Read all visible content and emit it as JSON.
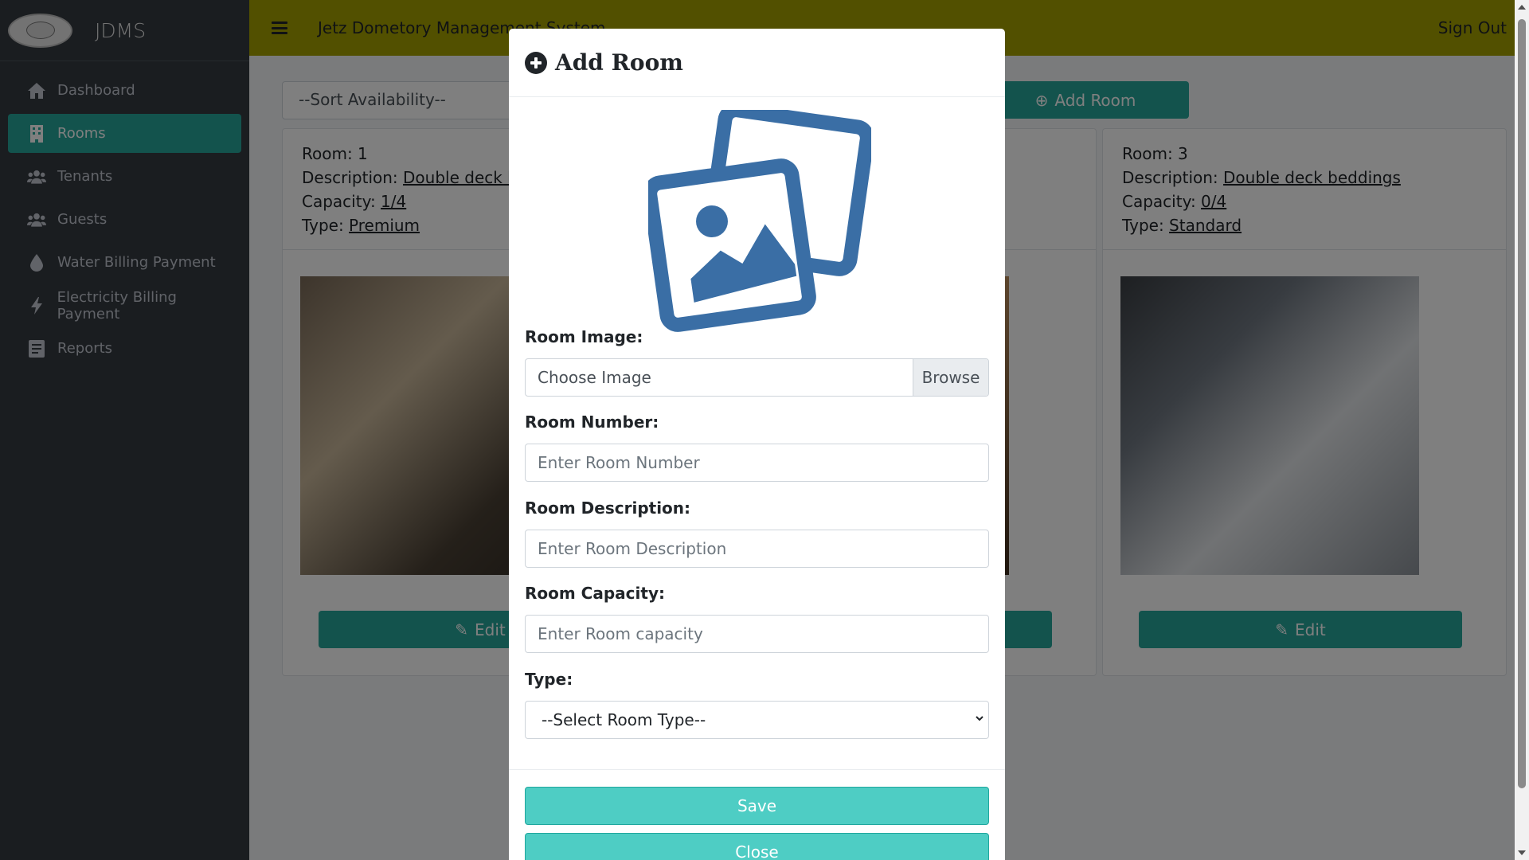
{
  "brand": {
    "name": "JDMS"
  },
  "header": {
    "title": "Jetz Dometory Management System",
    "sign_out": "Sign Out"
  },
  "sidebar": {
    "items": [
      {
        "label": "Dashboard",
        "icon": "home-icon"
      },
      {
        "label": "Rooms",
        "icon": "building-icon",
        "active": true
      },
      {
        "label": "Tenants",
        "icon": "users-icon"
      },
      {
        "label": "Guests",
        "icon": "users-icon"
      },
      {
        "label": "Water Billing Payment",
        "icon": "droplet-icon"
      },
      {
        "label": "Electricity Billing Payment",
        "icon": "bolt-icon"
      },
      {
        "label": "Reports",
        "icon": "report-icon"
      }
    ]
  },
  "main": {
    "sort_placeholder": "--Sort Availability--",
    "add_room_label": "Add Room",
    "cards": [
      {
        "room": "Room: 1",
        "desc_label": "Description:",
        "desc": "Double deck bed",
        "cap_label": "Capacity:",
        "capacity": "1/4",
        "type_label": "Type:",
        "type": "Premium",
        "edit": "Edit"
      },
      {
        "room": "",
        "desc_label": "",
        "desc": "",
        "cap_label": "",
        "capacity": "",
        "type_label": "",
        "type": "",
        "edit": ""
      },
      {
        "room": "Room: 3",
        "desc_label": "Description:",
        "desc": "Double deck beddings",
        "cap_label": "Capacity:",
        "capacity": "0/4",
        "type_label": "Type:",
        "type": "Standard",
        "edit": "Edit"
      }
    ]
  },
  "modal": {
    "title": "Add Room",
    "image_label": "Room Image:",
    "image_value": "Choose Image",
    "browse": "Browse",
    "number_label": "Room Number:",
    "number_placeholder": "Enter Room Number",
    "desc_label": "Room Description:",
    "desc_placeholder": "Enter Room Description",
    "capacity_label": "Room Capacity:",
    "capacity_placeholder": "Enter Room capacity",
    "type_label": "Type:",
    "type_selected": "--Select Room Type--",
    "save": "Save",
    "close": "Close"
  },
  "colors": {
    "accent": "#26a69a",
    "header": "#a4a100",
    "sidebar": "#343a40",
    "modal_button": "#4ecdc4",
    "image_icon": "#3a6ea5"
  }
}
